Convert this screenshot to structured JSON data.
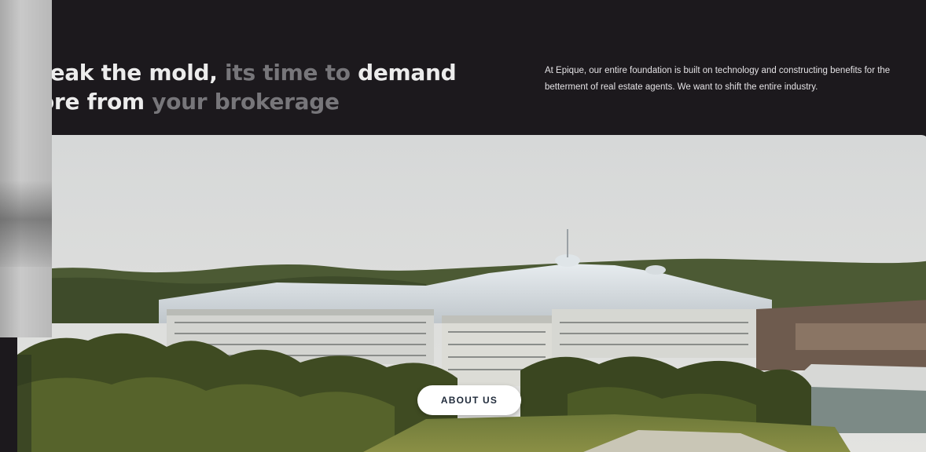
{
  "headline": {
    "line1": [
      {
        "text": "reak the mold,",
        "tone": "bright"
      },
      {
        "text": " its time to ",
        "tone": "dim"
      },
      {
        "text": "demand",
        "tone": "bright"
      }
    ],
    "line2": [
      {
        "text": "ore from",
        "tone": "bright"
      },
      {
        "text": " your brokerage",
        "tone": "dim"
      }
    ]
  },
  "intro": {
    "text": "At Epique, our entire foundation is built on technology and constructing benefits for the betterment of real estate agents. We want to shift the entire industry."
  },
  "hero": {
    "image_icon": "aerial-resort-photo"
  },
  "cta": {
    "label": "ABOUT US"
  },
  "colors": {
    "background": "#1c191d",
    "headline_bright": "#ececec",
    "headline_dim": "#77767a",
    "button_bg": "#ffffff",
    "button_text": "#1f2a3a"
  }
}
